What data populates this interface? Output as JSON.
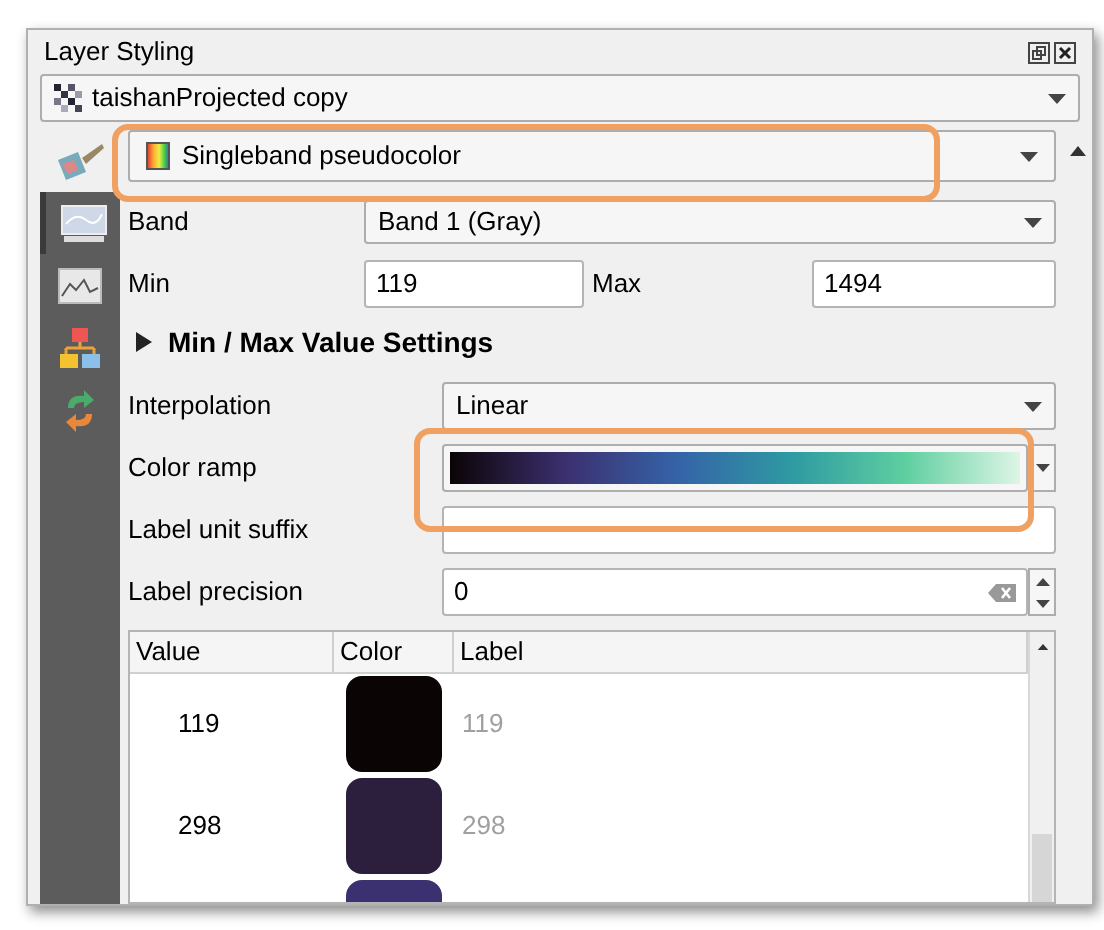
{
  "window": {
    "title": "Layer Styling"
  },
  "layer": {
    "value": "taishanProjected copy"
  },
  "renderer": {
    "value": "Singleband pseudocolor",
    "highlighted": true
  },
  "side_tabs": [
    {
      "kind": "symbology",
      "selected": false
    },
    {
      "kind": "transparency",
      "selected": true
    },
    {
      "kind": "histogram",
      "selected": false
    },
    {
      "kind": "rendering",
      "selected": false
    },
    {
      "kind": "history",
      "selected": false
    }
  ],
  "band": {
    "label": "Band",
    "value": "Band 1 (Gray)"
  },
  "min": {
    "label": "Min",
    "value": "119"
  },
  "max": {
    "label": "Max",
    "value": "1494"
  },
  "section": {
    "title": "Min / Max Value Settings",
    "expanded": false
  },
  "interpolation": {
    "label": "Interpolation",
    "value": "Linear"
  },
  "color_ramp": {
    "label": "Color ramp",
    "highlighted": true
  },
  "unit_suffix": {
    "label": "Label unit suffix"
  },
  "precision": {
    "label": "Label precision",
    "value": "0"
  },
  "table": {
    "columns": [
      "Value",
      "Color",
      "Label"
    ],
    "rows": [
      {
        "value": "119",
        "color": "#0b0405",
        "label": "119"
      },
      {
        "value": "298",
        "color": "#2c1e3d",
        "label": "298"
      },
      {
        "color": "#3b3070"
      }
    ]
  }
}
